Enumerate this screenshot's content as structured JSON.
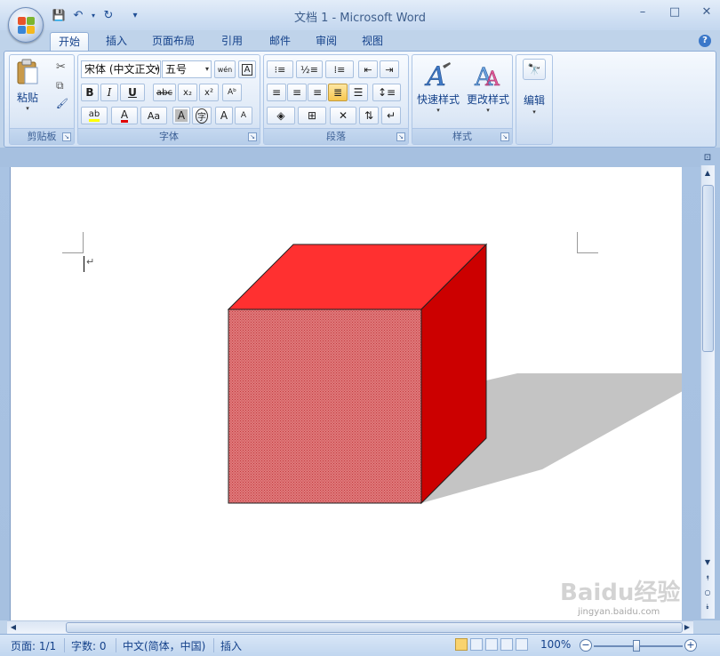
{
  "window": {
    "title": "文档 1 - Microsoft Word",
    "controls": {
      "minimize": "–",
      "maximize": "□",
      "close": "✕"
    }
  },
  "qat": {
    "save_icon": "💾",
    "undo_icon": "↶",
    "redo_icon": "↻",
    "customize": "▾"
  },
  "tabs": [
    {
      "label": "开始",
      "active": true
    },
    {
      "label": "插入"
    },
    {
      "label": "页面布局"
    },
    {
      "label": "引用"
    },
    {
      "label": "邮件"
    },
    {
      "label": "审阅"
    },
    {
      "label": "视图"
    }
  ],
  "help": "?",
  "ribbon": {
    "clipboard": {
      "label": "剪贴板",
      "paste": "粘贴",
      "cut_icon": "✂",
      "copy_icon": "⧉",
      "format_painter_icon": "🖌"
    },
    "font": {
      "label": "字体",
      "font_name": "宋体 (中文正文)",
      "font_size": "五号",
      "phonetic_icon": "wén",
      "char_border_icon": "A",
      "bold": "B",
      "italic": "I",
      "underline": "U",
      "strike": "abc",
      "subscript": "x₂",
      "superscript": "x²",
      "clear_format_icon": "Aᵇ",
      "highlight": "ab",
      "font_color": "A",
      "change_case": "Aa",
      "char_shading": "A",
      "enclosed": "字",
      "grow": "A",
      "shrink": "A"
    },
    "paragraph": {
      "label": "段落"
    },
    "styles": {
      "label": "样式",
      "quick_styles": "快速样式",
      "change_styles": "更改样式"
    },
    "editing": {
      "label": "编辑",
      "find_icon": "🔭"
    }
  },
  "status": {
    "page": "页面: 1/1",
    "words": "字数: 0",
    "language": "中文(简体，中国)",
    "mode": "插入",
    "zoom": "100%",
    "zoom_out": "−",
    "zoom_in": "+"
  },
  "watermark": {
    "logo": "Baidu经验",
    "url": "jingyan.baidu.com"
  },
  "colors": {
    "cube_front": "#d9787a",
    "cube_top": "#ff3030",
    "cube_right": "#cc0000",
    "shadow": "#c4c4c4"
  }
}
